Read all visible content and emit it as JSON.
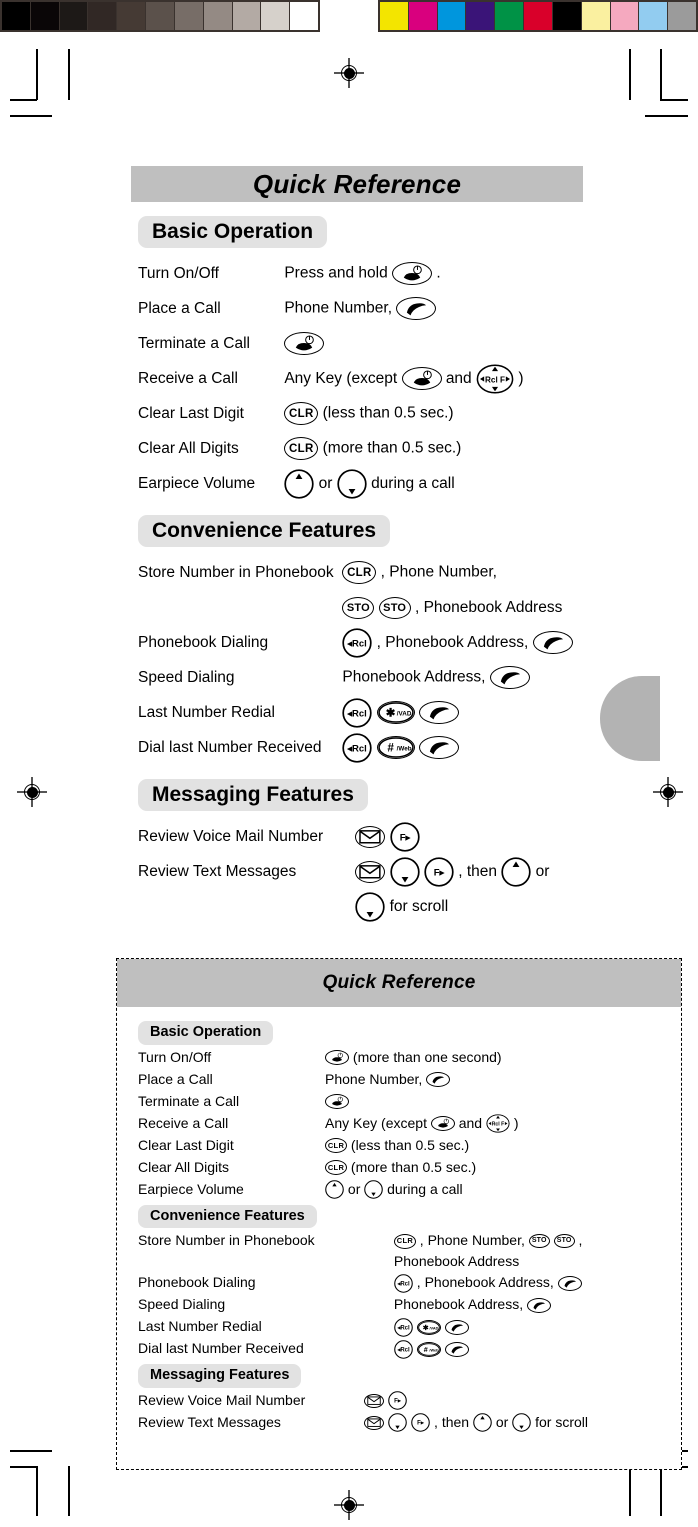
{
  "page": {
    "title": "Quick Reference",
    "bottom_card_title": "Quick Reference"
  },
  "calibration": {
    "gray_strip": {
      "name": "grayscale-step-wedge",
      "swatches": [
        "#000000",
        "#0a0607",
        "#1d1917",
        "#312825",
        "#453a34",
        "#5b514b",
        "#776d67",
        "#948a84",
        "#b3aaa4",
        "#d6d1cb",
        "#ffffff"
      ]
    },
    "color_strip": {
      "name": "color-control-bar",
      "swatches": [
        "#f3e500",
        "#d9007e",
        "#0096dd",
        "#3a1478",
        "#009246",
        "#d9002a",
        "#000000",
        "#faf0a0",
        "#f5a9bf",
        "#92ccf0",
        "#9b9b9b"
      ]
    }
  },
  "sections": [
    {
      "id": "basic-operation",
      "heading": "Basic Operation",
      "rows": [
        {
          "label": "Turn On/Off",
          "parts": [
            {
              "t": "text",
              "v": "Press and hold"
            },
            {
              "t": "key",
              "k": "end"
            },
            {
              "t": "text",
              "v": "."
            }
          ]
        },
        {
          "label": "Place a Call",
          "parts": [
            {
              "t": "text",
              "v": "Phone Number,"
            },
            {
              "t": "key",
              "k": "send"
            }
          ]
        },
        {
          "label": "Terminate a Call",
          "parts": [
            {
              "t": "key",
              "k": "end"
            }
          ]
        },
        {
          "label": "Receive a Call",
          "parts": [
            {
              "t": "text",
              "v": "Any Key (except"
            },
            {
              "t": "key",
              "k": "end"
            },
            {
              "t": "text",
              "v": "and"
            },
            {
              "t": "key",
              "k": "nav"
            },
            {
              "t": "text",
              "v": ")"
            }
          ]
        },
        {
          "label": "Clear Last Digit",
          "parts": [
            {
              "t": "key",
              "k": "clr"
            },
            {
              "t": "text",
              "v": "(less than 0.5 sec.)"
            }
          ]
        },
        {
          "label": "Clear All Digits",
          "parts": [
            {
              "t": "key",
              "k": "clr"
            },
            {
              "t": "text",
              "v": "(more than 0.5 sec.)"
            }
          ]
        },
        {
          "label": "Earpiece Volume",
          "parts": [
            {
              "t": "key",
              "k": "up"
            },
            {
              "t": "text",
              "v": "or"
            },
            {
              "t": "key",
              "k": "down"
            },
            {
              "t": "text",
              "v": "during a call"
            }
          ]
        }
      ]
    },
    {
      "id": "convenience-features",
      "heading": "Convenience Features",
      "rows": [
        {
          "label": "Store Number in Phonebook",
          "parts": [
            {
              "t": "key",
              "k": "clr"
            },
            {
              "t": "text",
              "v": ", Phone Number,"
            }
          ],
          "parts2": [
            {
              "t": "key",
              "k": "sto"
            },
            {
              "t": "key",
              "k": "sto"
            },
            {
              "t": "text",
              "v": ", Phonebook Address"
            }
          ]
        },
        {
          "label": "Phonebook Dialing",
          "parts": [
            {
              "t": "key",
              "k": "rcl"
            },
            {
              "t": "text",
              "v": ", Phonebook Address,"
            },
            {
              "t": "key",
              "k": "send"
            }
          ]
        },
        {
          "label": "Speed Dialing",
          "parts": [
            {
              "t": "text",
              "v": "Phonebook Address,"
            },
            {
              "t": "key",
              "k": "send"
            }
          ]
        },
        {
          "label": "Last Number Redial",
          "parts": [
            {
              "t": "key",
              "k": "rcl"
            },
            {
              "t": "key",
              "k": "star"
            },
            {
              "t": "key",
              "k": "send"
            }
          ]
        },
        {
          "label": "Dial last Number Received",
          "parts": [
            {
              "t": "key",
              "k": "rcl"
            },
            {
              "t": "key",
              "k": "hash"
            },
            {
              "t": "key",
              "k": "send"
            }
          ]
        }
      ]
    },
    {
      "id": "messaging-features",
      "heading": "Messaging Features",
      "rows": [
        {
          "label": "Review Voice Mail Number",
          "parts": [
            {
              "t": "key",
              "k": "env"
            },
            {
              "t": "key",
              "k": "fwd"
            }
          ]
        },
        {
          "label": "Review Text Messages",
          "parts": [
            {
              "t": "key",
              "k": "env"
            },
            {
              "t": "key",
              "k": "down"
            },
            {
              "t": "key",
              "k": "fwd"
            },
            {
              "t": "text",
              "v": ", then"
            },
            {
              "t": "key",
              "k": "up"
            },
            {
              "t": "text",
              "v": "or"
            }
          ],
          "parts2": [
            {
              "t": "key",
              "k": "down"
            },
            {
              "t": "text",
              "v": "for scroll"
            }
          ]
        }
      ]
    }
  ],
  "cut_card_sections": [
    {
      "id": "basic-operation-compact",
      "heading": "Basic Operation",
      "rows": [
        {
          "label": "Turn On/Off",
          "parts": [
            {
              "t": "key",
              "k": "end"
            },
            {
              "t": "text",
              "v": "(more than one second)"
            }
          ]
        },
        {
          "label": "Place a Call",
          "parts": [
            {
              "t": "text",
              "v": "Phone Number,"
            },
            {
              "t": "key",
              "k": "send"
            }
          ]
        },
        {
          "label": "Terminate a Call",
          "parts": [
            {
              "t": "key",
              "k": "end"
            }
          ]
        },
        {
          "label": "Receive a Call",
          "parts": [
            {
              "t": "text",
              "v": "Any Key (except"
            },
            {
              "t": "key",
              "k": "end"
            },
            {
              "t": "text",
              "v": "and"
            },
            {
              "t": "key",
              "k": "nav"
            },
            {
              "t": "text",
              "v": ")"
            }
          ]
        },
        {
          "label": "Clear Last Digit",
          "parts": [
            {
              "t": "key",
              "k": "clr"
            },
            {
              "t": "text",
              "v": "(less than 0.5 sec.)"
            }
          ]
        },
        {
          "label": "Clear All Digits",
          "parts": [
            {
              "t": "key",
              "k": "clr"
            },
            {
              "t": "text",
              "v": "(more than 0.5 sec.)"
            }
          ]
        },
        {
          "label": "Earpiece Volume",
          "parts": [
            {
              "t": "key",
              "k": "up"
            },
            {
              "t": "text",
              "v": "or"
            },
            {
              "t": "key",
              "k": "down"
            },
            {
              "t": "text",
              "v": "during a call"
            }
          ]
        }
      ]
    },
    {
      "id": "convenience-features-compact",
      "heading": "Convenience Features",
      "rows": [
        {
          "label": "Store Number in Phonebook",
          "parts": [
            {
              "t": "key",
              "k": "clr"
            },
            {
              "t": "text",
              "v": ", Phone Number,"
            },
            {
              "t": "key",
              "k": "sto"
            },
            {
              "t": "key",
              "k": "sto"
            },
            {
              "t": "text",
              "v": ","
            }
          ],
          "parts2": [
            {
              "t": "text",
              "v": "Phonebook Address"
            }
          ]
        },
        {
          "label": "Phonebook Dialing",
          "parts": [
            {
              "t": "key",
              "k": "rcl"
            },
            {
              "t": "text",
              "v": ", Phonebook Address,"
            },
            {
              "t": "key",
              "k": "send"
            }
          ]
        },
        {
          "label": "Speed Dialing",
          "parts": [
            {
              "t": "text",
              "v": "Phonebook Address,"
            },
            {
              "t": "key",
              "k": "send"
            }
          ]
        },
        {
          "label": "Last Number Redial",
          "parts": [
            {
              "t": "key",
              "k": "rcl"
            },
            {
              "t": "key",
              "k": "star"
            },
            {
              "t": "key",
              "k": "send"
            }
          ]
        },
        {
          "label": "Dial last Number Received",
          "parts": [
            {
              "t": "key",
              "k": "rcl"
            },
            {
              "t": "key",
              "k": "hash"
            },
            {
              "t": "key",
              "k": "send"
            }
          ]
        }
      ]
    },
    {
      "id": "messaging-features-compact",
      "heading": "Messaging Features",
      "rows": [
        {
          "label": "Review Voice Mail Number",
          "parts": [
            {
              "t": "key",
              "k": "env"
            },
            {
              "t": "key",
              "k": "fwd"
            }
          ]
        },
        {
          "label": "Review Text Messages",
          "parts": [
            {
              "t": "key",
              "k": "env"
            },
            {
              "t": "key",
              "k": "down"
            },
            {
              "t": "key",
              "k": "fwd"
            },
            {
              "t": "text",
              "v": ", then"
            },
            {
              "t": "key",
              "k": "up"
            },
            {
              "t": "text",
              "v": "or"
            },
            {
              "t": "key",
              "k": "down"
            },
            {
              "t": "text",
              "v": "for scroll"
            }
          ]
        }
      ]
    }
  ],
  "key_glyphs": {
    "end": {
      "name": "end-power-key-icon",
      "label": ""
    },
    "send": {
      "name": "send-call-key-icon",
      "label": ""
    },
    "clr": {
      "name": "clear-key-icon",
      "label": "CLR"
    },
    "sto": {
      "name": "store-key-icon",
      "label": "STO"
    },
    "rcl": {
      "name": "recall-key-icon",
      "label": "Rcl"
    },
    "fwd": {
      "name": "forward-key-icon",
      "label": "F"
    },
    "star": {
      "name": "star-vad-key-icon",
      "label": "/VAD"
    },
    "hash": {
      "name": "hash-web-key-icon",
      "label": "/Web"
    },
    "up": {
      "name": "scroll-up-key-icon",
      "label": ""
    },
    "down": {
      "name": "scroll-down-key-icon",
      "label": ""
    },
    "env": {
      "name": "message-envelope-key-icon",
      "label": ""
    },
    "nav": {
      "name": "navigation-pad-key-icon",
      "label": "Rcl F"
    }
  },
  "colors": {
    "title_bar_gray": "#bfbfbf",
    "badge_gray": "#e2e2e2",
    "thumb_tab_gray": "#b3b3b3"
  }
}
